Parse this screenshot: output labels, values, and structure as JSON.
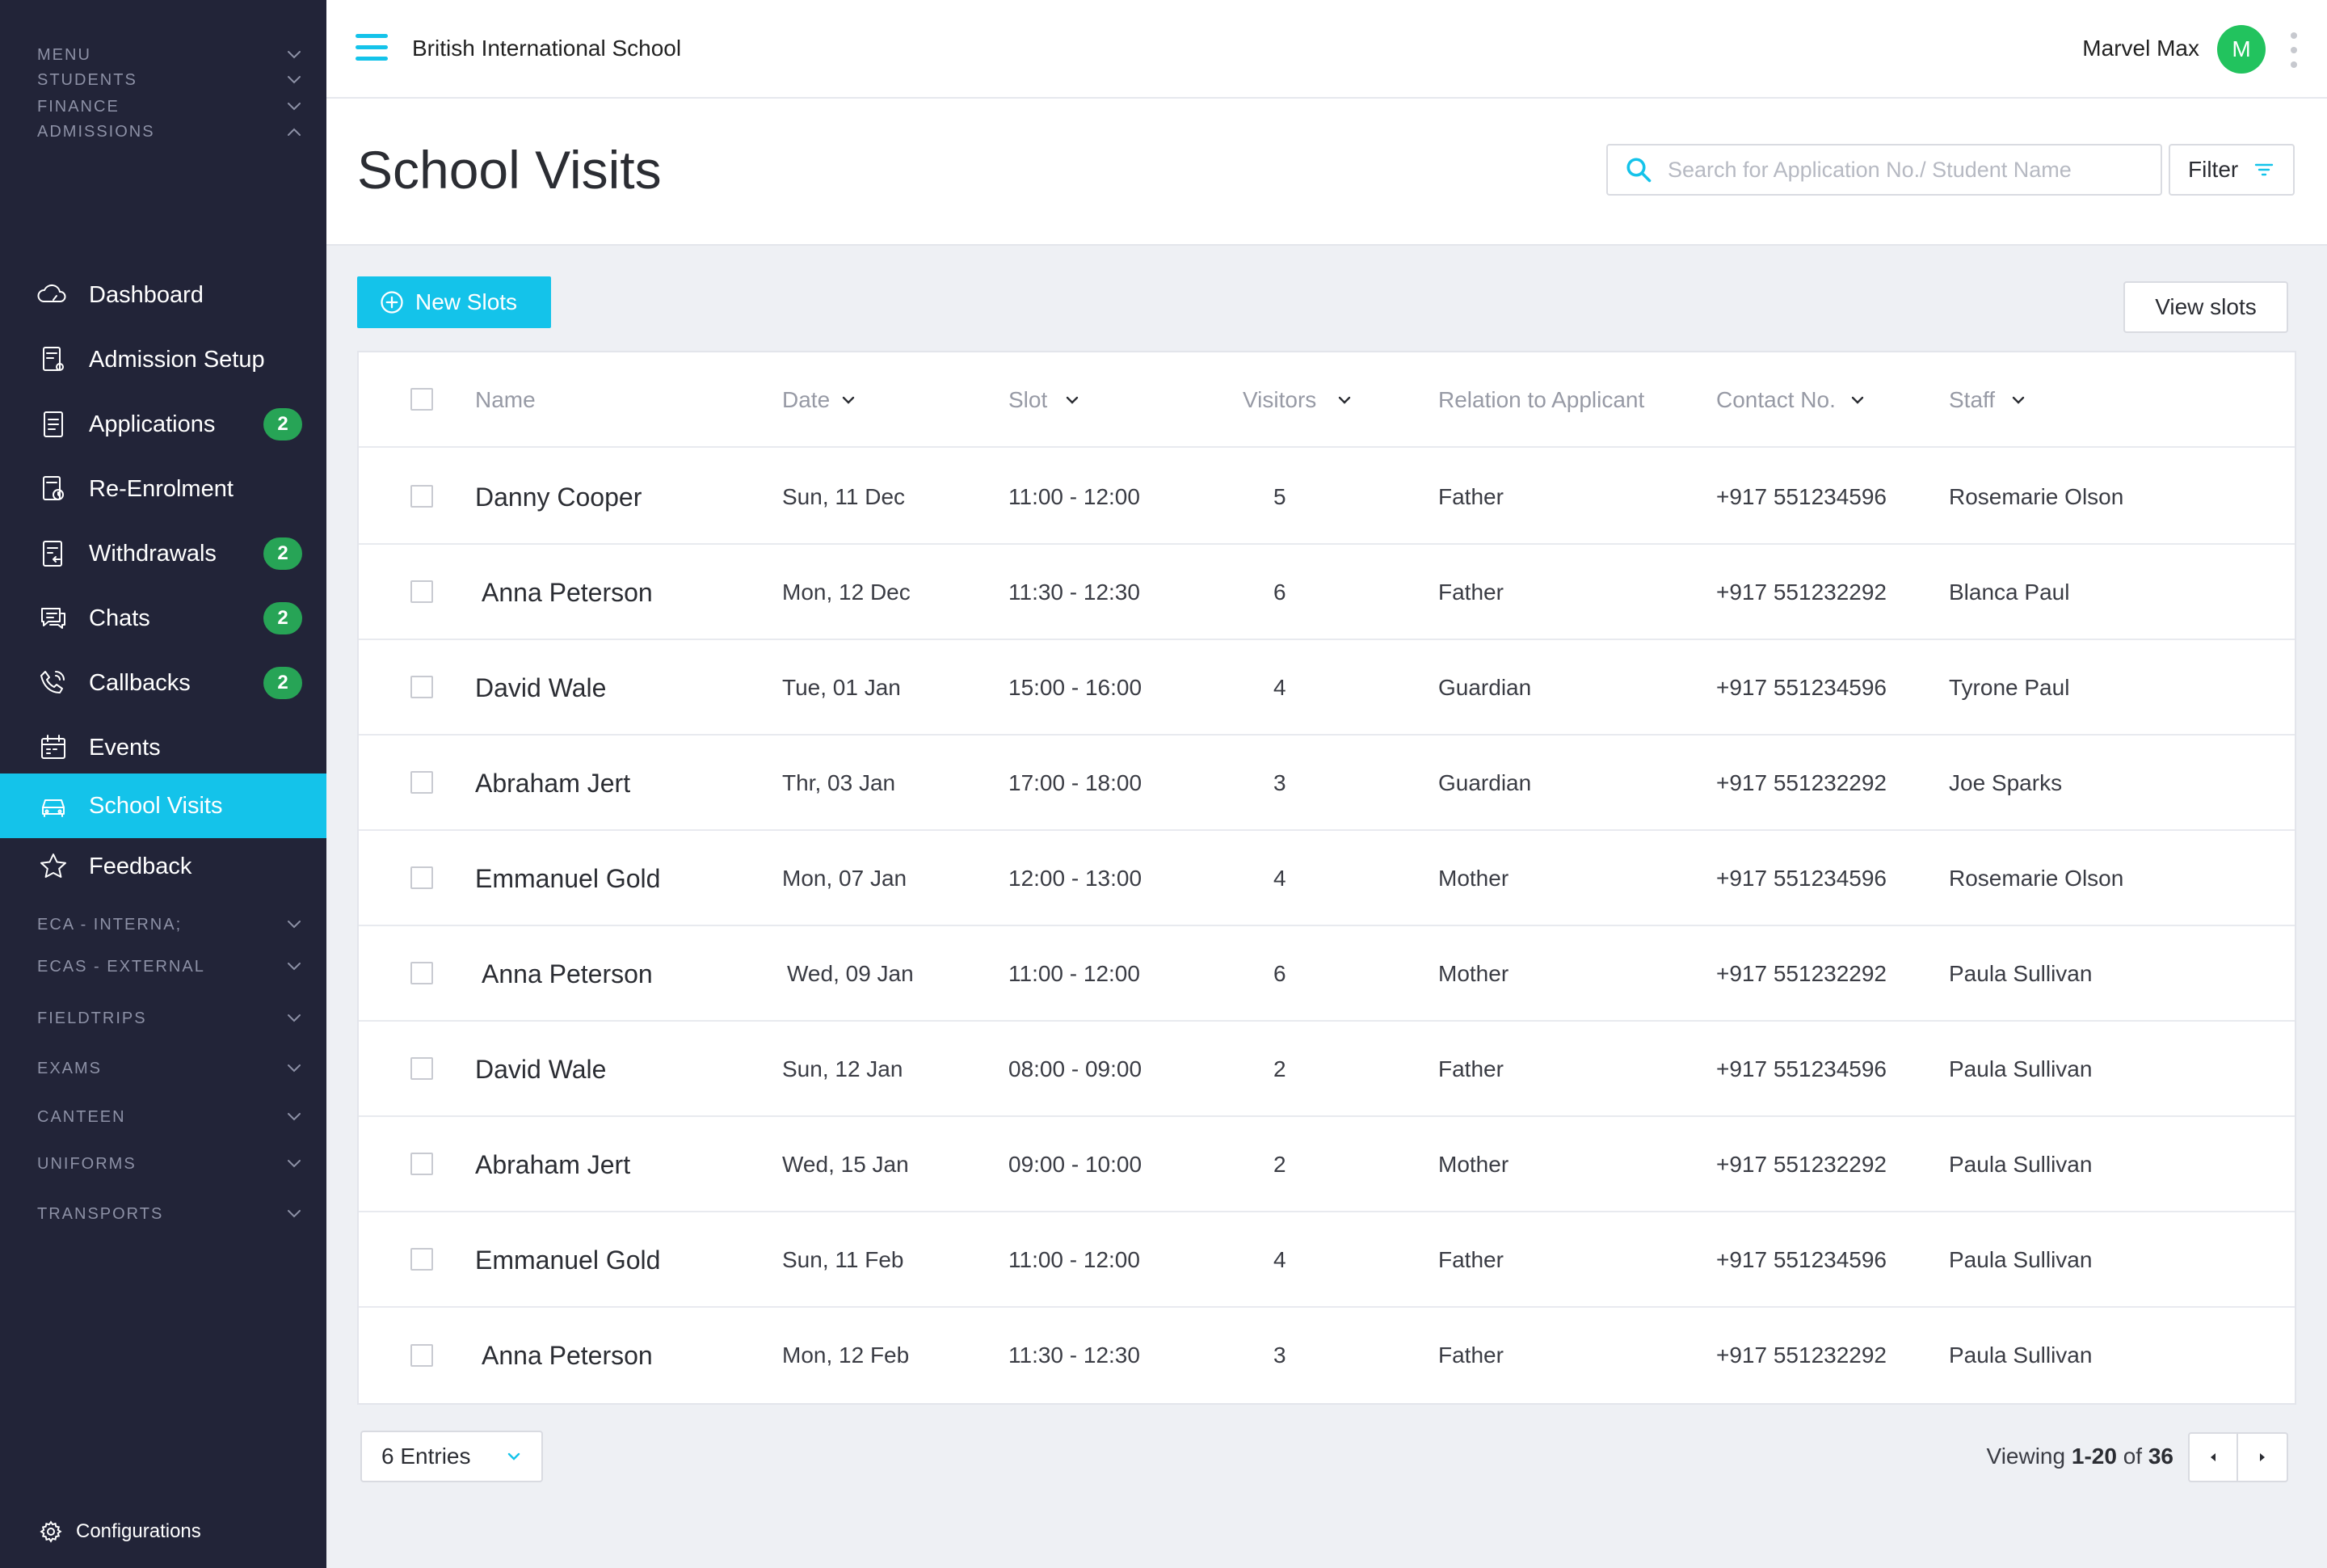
{
  "app": {
    "school_name": "British International School",
    "user_name": "Marvel Max",
    "user_initial": "M"
  },
  "colors": {
    "accent": "#14c3ea",
    "sidebar_bg": "#222438",
    "badge": "#27a456",
    "avatar": "#22c35e"
  },
  "sidebar": {
    "sections_top": [
      {
        "label": "MENU",
        "state": "collapsed"
      },
      {
        "label": "STUDENTS",
        "state": "collapsed"
      },
      {
        "label": "FINANCE",
        "state": "collapsed"
      },
      {
        "label": "ADMISSIONS",
        "state": "expanded"
      }
    ],
    "items": [
      {
        "label": "Dashboard",
        "icon": "dashboard-cloud-icon",
        "badge": ""
      },
      {
        "label": "Admission Setup",
        "icon": "admission-setup-icon",
        "badge": ""
      },
      {
        "label": "Applications",
        "icon": "applications-icon",
        "badge": "2"
      },
      {
        "label": "Re-Enrolment",
        "icon": "re-enrolment-icon",
        "badge": ""
      },
      {
        "label": "Withdrawals",
        "icon": "withdrawals-icon",
        "badge": "2"
      },
      {
        "label": "Chats",
        "icon": "chats-icon",
        "badge": "2"
      },
      {
        "label": "Callbacks",
        "icon": "callbacks-phone-icon",
        "badge": "2"
      },
      {
        "label": "Events",
        "icon": "calendar-icon",
        "badge": ""
      },
      {
        "label": "School Visits",
        "icon": "car-icon",
        "badge": "",
        "active": true
      },
      {
        "label": "Feedback",
        "icon": "star-icon",
        "badge": ""
      }
    ],
    "sections_bottom": [
      {
        "label": "ECA - INTERNA;"
      },
      {
        "label": "ECAS - EXTERNAL"
      },
      {
        "label": "FIELDTRIPS"
      },
      {
        "label": "EXAMS"
      },
      {
        "label": "CANTEEN"
      },
      {
        "label": "UNIFORMS"
      },
      {
        "label": "TRANSPORTS"
      }
    ],
    "configurations_label": "Configurations"
  },
  "page": {
    "title": "School Visits",
    "search_placeholder": "Search for Application No./ Student Name",
    "filter_label": "Filter",
    "new_slots_label": "New Slots",
    "view_slots_label": "View slots"
  },
  "table": {
    "headers": {
      "name": "Name",
      "date": "Date",
      "slot": "Slot",
      "visitors": "Visitors",
      "relation": "Relation to Applicant",
      "contact": "Contact No.",
      "staff": "Staff"
    },
    "rows": [
      {
        "name": "Danny Cooper",
        "date": "Sun, 11 Dec",
        "slot": "11:00 - 12:00",
        "visitors": "5",
        "relation": "Father",
        "contact": "+917 551234596",
        "staff": "Rosemarie Olson"
      },
      {
        "name": " Anna Peterson",
        "date": "Mon, 12 Dec",
        "slot": "11:30 - 12:30",
        "visitors": "6",
        "relation": "Father",
        "contact": "+917 551232292",
        "staff": "Blanca Paul"
      },
      {
        "name": "David Wale",
        "date": "Tue, 01 Jan",
        "slot": "15:00 - 16:00",
        "visitors": "4",
        "relation": "Guardian",
        "contact": "+917 551234596",
        "staff": "Tyrone Paul"
      },
      {
        "name": "Abraham Jert",
        "date": "Thr, 03 Jan",
        "slot": "17:00 -  18:00",
        "visitors": "3",
        "relation": "Guardian",
        "contact": "+917 551232292",
        "staff": "Joe Sparks"
      },
      {
        "name": "Emmanuel Gold",
        "date": "Mon, 07 Jan",
        "slot": "12:00 - 13:00",
        "visitors": "4",
        "relation": "Mother",
        "contact": "+917 551234596",
        "staff": "Rosemarie Olson"
      },
      {
        "name": " Anna Peterson",
        "date": " Wed, 09 Jan",
        "slot": "11:00 - 12:00",
        "visitors": "6",
        "relation": "Mother",
        "contact": "+917 551232292",
        "staff": "Paula Sullivan"
      },
      {
        "name": "David Wale",
        "date": "Sun, 12 Jan",
        "slot": "08:00 - 09:00",
        "visitors": "2",
        "relation": "Father",
        "contact": "+917 551234596",
        "staff": "Paula Sullivan"
      },
      {
        "name": "Abraham Jert",
        "date": "Wed, 15 Jan",
        "slot": "09:00 - 10:00",
        "visitors": "2",
        "relation": "Mother",
        "contact": "+917 551232292",
        "staff": "Paula Sullivan"
      },
      {
        "name": "Emmanuel Gold",
        "date": "Sun, 11 Feb",
        "slot": "11:00 - 12:00",
        "visitors": "4",
        "relation": "Father",
        "contact": "+917 551234596",
        "staff": "Paula Sullivan"
      },
      {
        "name": " Anna Peterson",
        "date": "Mon, 12 Feb",
        "slot": "11:30 - 12:30",
        "visitors": "3",
        "relation": "Father",
        "contact": "+917 551232292",
        "staff": "Paula Sullivan"
      }
    ]
  },
  "footer": {
    "entries_label": "6 Entries",
    "viewing_prefix": "Viewing",
    "viewing_range": "1-20",
    "viewing_of": "of",
    "viewing_total": "36"
  }
}
